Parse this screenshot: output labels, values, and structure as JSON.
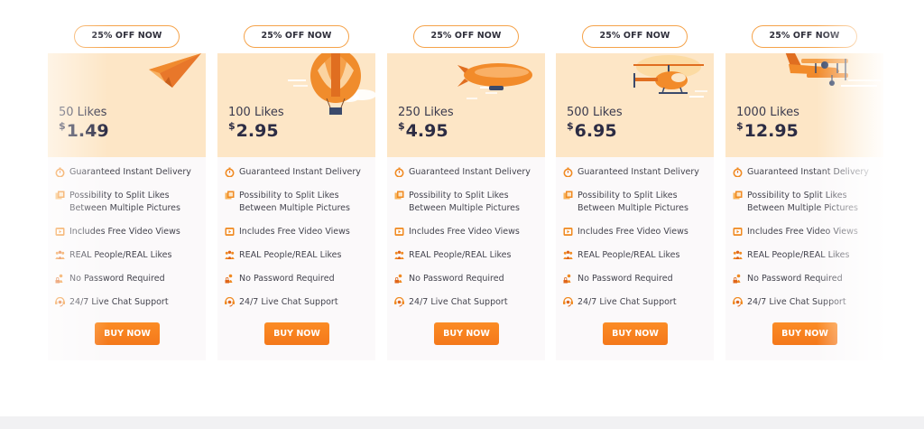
{
  "plans": [
    {
      "badge": "25% OFF NOW",
      "likes": "50 Likes",
      "currency": "$",
      "amount": "1.49",
      "buy": "BUY NOW"
    },
    {
      "badge": "25% OFF NOW",
      "likes": "100 Likes",
      "currency": "$",
      "amount": "2.95",
      "buy": "BUY NOW"
    },
    {
      "badge": "25% OFF NOW",
      "likes": "250 Likes",
      "currency": "$",
      "amount": "4.95",
      "buy": "BUY NOW"
    },
    {
      "badge": "25% OFF NOW",
      "likes": "500 Likes",
      "currency": "$",
      "amount": "6.95",
      "buy": "BUY NOW"
    },
    {
      "badge": "25% OFF NOW",
      "likes": "1000 Likes",
      "currency": "$",
      "amount": "12.95",
      "buy": "BUY NOW"
    }
  ],
  "features": [
    {
      "text": "Guaranteed Instant Delivery",
      "icon": "stopwatch-icon"
    },
    {
      "text": "Possibility to Split Likes Between Multiple Pictures",
      "icon": "pictures-icon"
    },
    {
      "text": "Includes Free Video Views",
      "icon": "video-icon"
    },
    {
      "text": "REAL People/REAL Likes",
      "icon": "people-icon"
    },
    {
      "text": "No Password Required",
      "icon": "no-password-icon"
    },
    {
      "text": "24/7 Live Chat Support",
      "icon": "chat-support-icon"
    }
  ],
  "colors": {
    "accent": "#f4781a",
    "hero": "#fde6c6",
    "text": "#2c2c44"
  }
}
